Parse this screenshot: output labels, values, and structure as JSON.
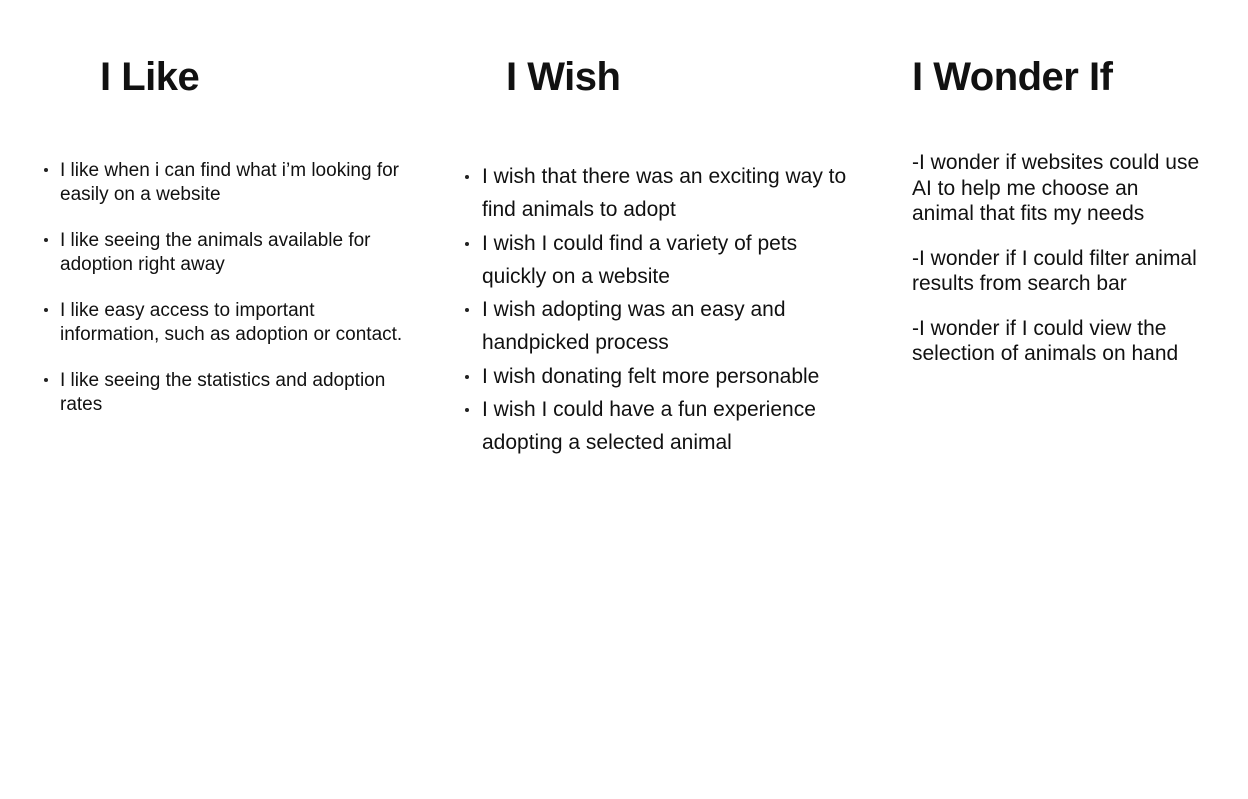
{
  "columns": {
    "like": {
      "heading": "I Like",
      "items": [
        "I like when i can find what i’m looking for easily on a website",
        "I like seeing the animals available for adoption right away",
        "I like easy access to important information, such as adoption or contact.",
        "I like seeing the statistics and adoption rates"
      ]
    },
    "wish": {
      "heading": "I Wish",
      "items": [
        "I wish that there was an exciting way to find animals to adopt",
        "I wish I could find a variety of pets quickly on a website",
        "I wish adopting was an easy and handpicked process",
        "I wish donating felt more personable",
        "I wish I could have a fun experience adopting a selected animal"
      ]
    },
    "wonder": {
      "heading": "I Wonder If",
      "items": [
        "-I wonder if websites could use AI to help me choose an animal that fits my needs",
        "-I wonder if I could filter animal results from search bar",
        "-I wonder if I could view the selection of animals on hand"
      ]
    }
  }
}
